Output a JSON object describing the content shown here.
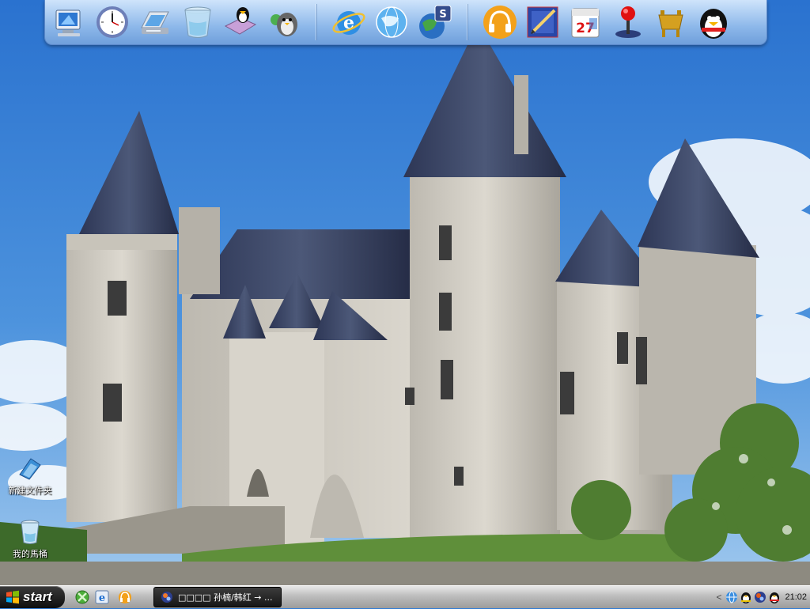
{
  "colors": {
    "sky_top": "#2a72cf",
    "sky_bottom": "#8fc0ec",
    "stone": "#cfccc4",
    "roof": "#3b4666",
    "grass": "#5f8f3a",
    "taskbar": "#bdbdbd",
    "start_button": "#111111"
  },
  "dock": {
    "group1": [
      "my-computer-icon",
      "clock-icon",
      "scanner-icon",
      "recycle-bin-icon",
      "qq-penguin-book-icon",
      "qq-users-icon"
    ],
    "group2": [
      "internet-explorer-icon",
      "network-globe-icon",
      "ftp-globe-icon"
    ],
    "group3": [
      "headphones-icon",
      "notepad-pencil-icon",
      "calendar-icon",
      "joystick-icon",
      "chinese-cauldron-icon",
      "qq-penguin-icon"
    ],
    "calendar_day": "27"
  },
  "desktop": {
    "icons": [
      {
        "label": "新建文件夹",
        "icon": "new-folder-icon"
      },
      {
        "label": "我的馬桶",
        "icon": "recycle-bin-icon"
      }
    ]
  },
  "taskbar": {
    "start_label": "start",
    "quick_launch": [
      "xbox-icon",
      "ie-quick-icon",
      "headphones-quick-icon"
    ],
    "active_task": {
      "label": "□□□□ 孙楠/韩红 → ...",
      "icon": "media-player-icon"
    },
    "tray": {
      "chevron": "<",
      "icons": [
        "network-globe-tray-icon",
        "qq-tray-icon",
        "media-tray-icon",
        "qq-penguin-tray-icon"
      ],
      "clock": "21:02"
    }
  }
}
